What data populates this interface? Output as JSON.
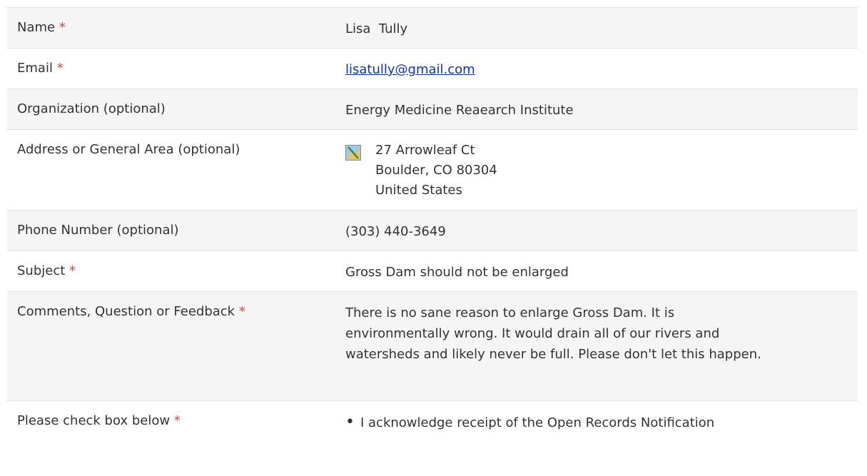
{
  "rows": [
    {
      "label": "Name",
      "required": "*",
      "value": "Lisa  Tully"
    },
    {
      "label": "Email",
      "required": "*",
      "value": "lisatully@gmail.com"
    },
    {
      "label": "Organization (optional)",
      "value": "Energy Medicine Reaearch Institute"
    },
    {
      "label": "Address or General Area (optional)",
      "address": {
        "line1": "27 Arrowleaf Ct",
        "line2": "Boulder, CO 80304",
        "line3": "United States"
      }
    },
    {
      "label": "Phone Number (optional)",
      "value": "(303) 440-3649"
    },
    {
      "label": "Subject",
      "required": "*",
      "value": "Gross Dam should not be enlarged"
    },
    {
      "label": "Comments, Question or Feedback",
      "required": "*",
      "value": "There is no sane reason to enlarge Gross Dam. It is environmentally wrong. It would drain all of our rivers and watersheds and likely never be full. Please don't let this happen."
    },
    {
      "label": "Please check box below",
      "required": "*",
      "value": "I acknowledge receipt of the Open Records Notification"
    }
  ],
  "icons": {
    "address": "map-icon"
  }
}
